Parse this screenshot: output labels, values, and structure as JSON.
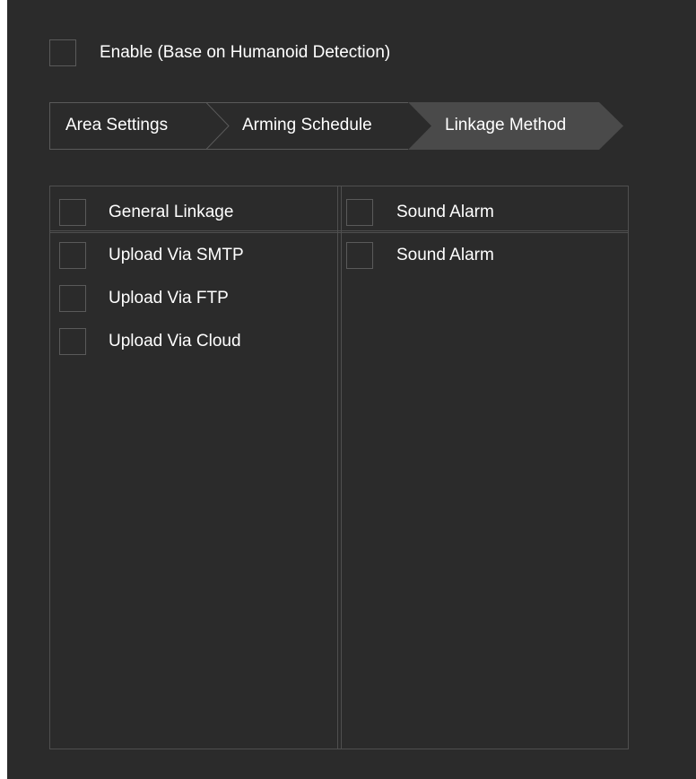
{
  "enable": {
    "label": "Enable (Base on Humanoid Detection)",
    "checked": false
  },
  "tabs": [
    {
      "label": "Area Settings",
      "active": false
    },
    {
      "label": "Arming Schedule",
      "active": false
    },
    {
      "label": "Linkage Method",
      "active": true
    }
  ],
  "linkage": {
    "left_header": {
      "label": "General Linkage",
      "checked": false
    },
    "left_items": [
      {
        "label": "Upload Via SMTP",
        "checked": false
      },
      {
        "label": "Upload Via FTP",
        "checked": false
      },
      {
        "label": "Upload Via Cloud",
        "checked": false
      }
    ],
    "right_header": {
      "label": "Sound Alarm",
      "checked": false
    },
    "right_items": [
      {
        "label": "Sound Alarm",
        "checked": false
      }
    ]
  },
  "colors": {
    "panel_bg": "#2b2b2b",
    "tab_active_bg": "#4a4a4a",
    "border": "#4f4f4f",
    "text": "#ffffff"
  }
}
